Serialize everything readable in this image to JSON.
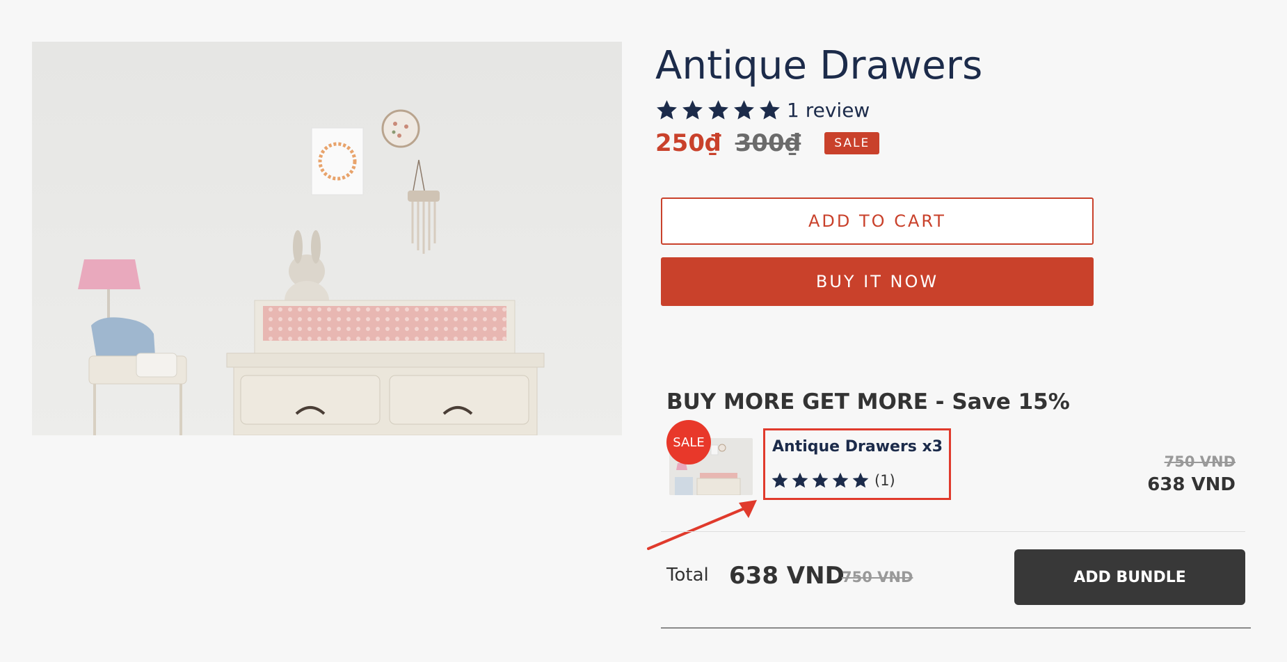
{
  "product": {
    "title": "Antique Drawers",
    "rating": 5,
    "review_count": "1 review",
    "sale_price": "250₫",
    "compare_price": "300₫",
    "sale_badge": "SALE"
  },
  "actions": {
    "add_to_cart": "ADD TO CART",
    "buy_it_now": "BUY IT NOW"
  },
  "bundle": {
    "heading": "BUY MORE GET MORE - Save 15%",
    "item": {
      "sale_badge": "SALE",
      "name": "Antique Drawers x3",
      "rating": 5,
      "rating_count": "(1)",
      "old_price": "750 VND",
      "new_price": "638 VND"
    },
    "total_label": "Total",
    "total_price": "638 VND",
    "total_old_price": "750 VND",
    "add_bundle": "ADD BUNDLE"
  },
  "colors": {
    "accent": "#c9412b",
    "navy": "#1c2b4a",
    "dark_button": "#383838",
    "highlight": "#e03a2c"
  }
}
